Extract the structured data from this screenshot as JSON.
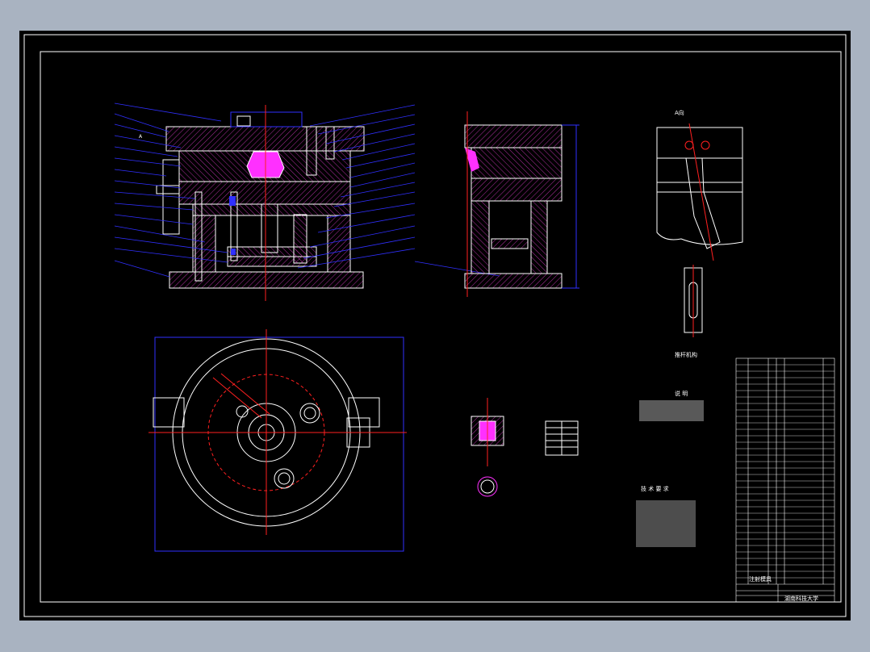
{
  "drawing": {
    "view_label_a": "A向",
    "view_label_b": "A",
    "caption_ejector": "推杆机构",
    "notes_title": "说 明",
    "tech_title": "技 术 要 求",
    "school": "湖南科技大学",
    "drawing_title": "注射模具"
  },
  "colors": {
    "outline": "#ffffff",
    "hatch": "#b030a0",
    "dimension": "#3030ff",
    "centerline": "#ff2020",
    "magenta": "#ff30ff",
    "frame": "#ffffff"
  }
}
